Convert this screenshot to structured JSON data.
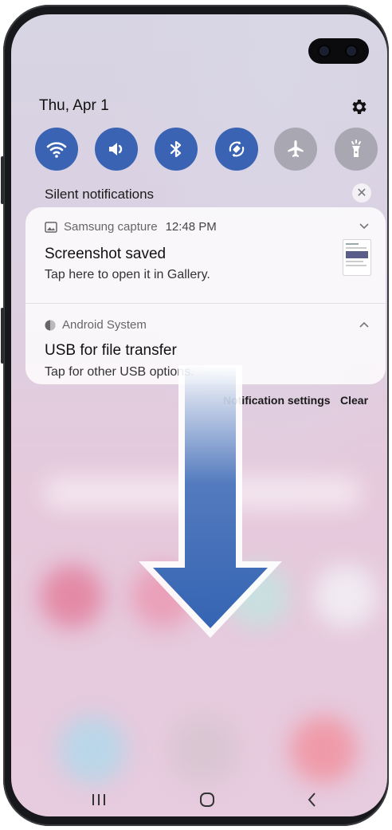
{
  "status": {
    "date": "Thu, Apr 1"
  },
  "quick_settings": [
    {
      "name": "wifi-icon",
      "active": true
    },
    {
      "name": "sound-icon",
      "active": true
    },
    {
      "name": "bluetooth-icon",
      "active": true
    },
    {
      "name": "auto-rotate-icon",
      "active": true
    },
    {
      "name": "airplane-mode-icon",
      "active": false
    },
    {
      "name": "flashlight-icon",
      "active": false
    }
  ],
  "section": {
    "silent_label": "Silent notifications"
  },
  "notifications": [
    {
      "app": "Samsung capture",
      "time": "12:48 PM",
      "title": "Screenshot saved",
      "body": "Tap here to open it in Gallery."
    },
    {
      "app": "Android System",
      "title": "USB for file transfer",
      "body": "Tap for other USB options."
    }
  ],
  "actions": {
    "settings_label": "Notification settings",
    "clear_label": "Clear"
  },
  "colors": {
    "qs_active": "#3a63b4",
    "qs_inactive": "#a9a7b2",
    "arrow": "#3564b3"
  }
}
